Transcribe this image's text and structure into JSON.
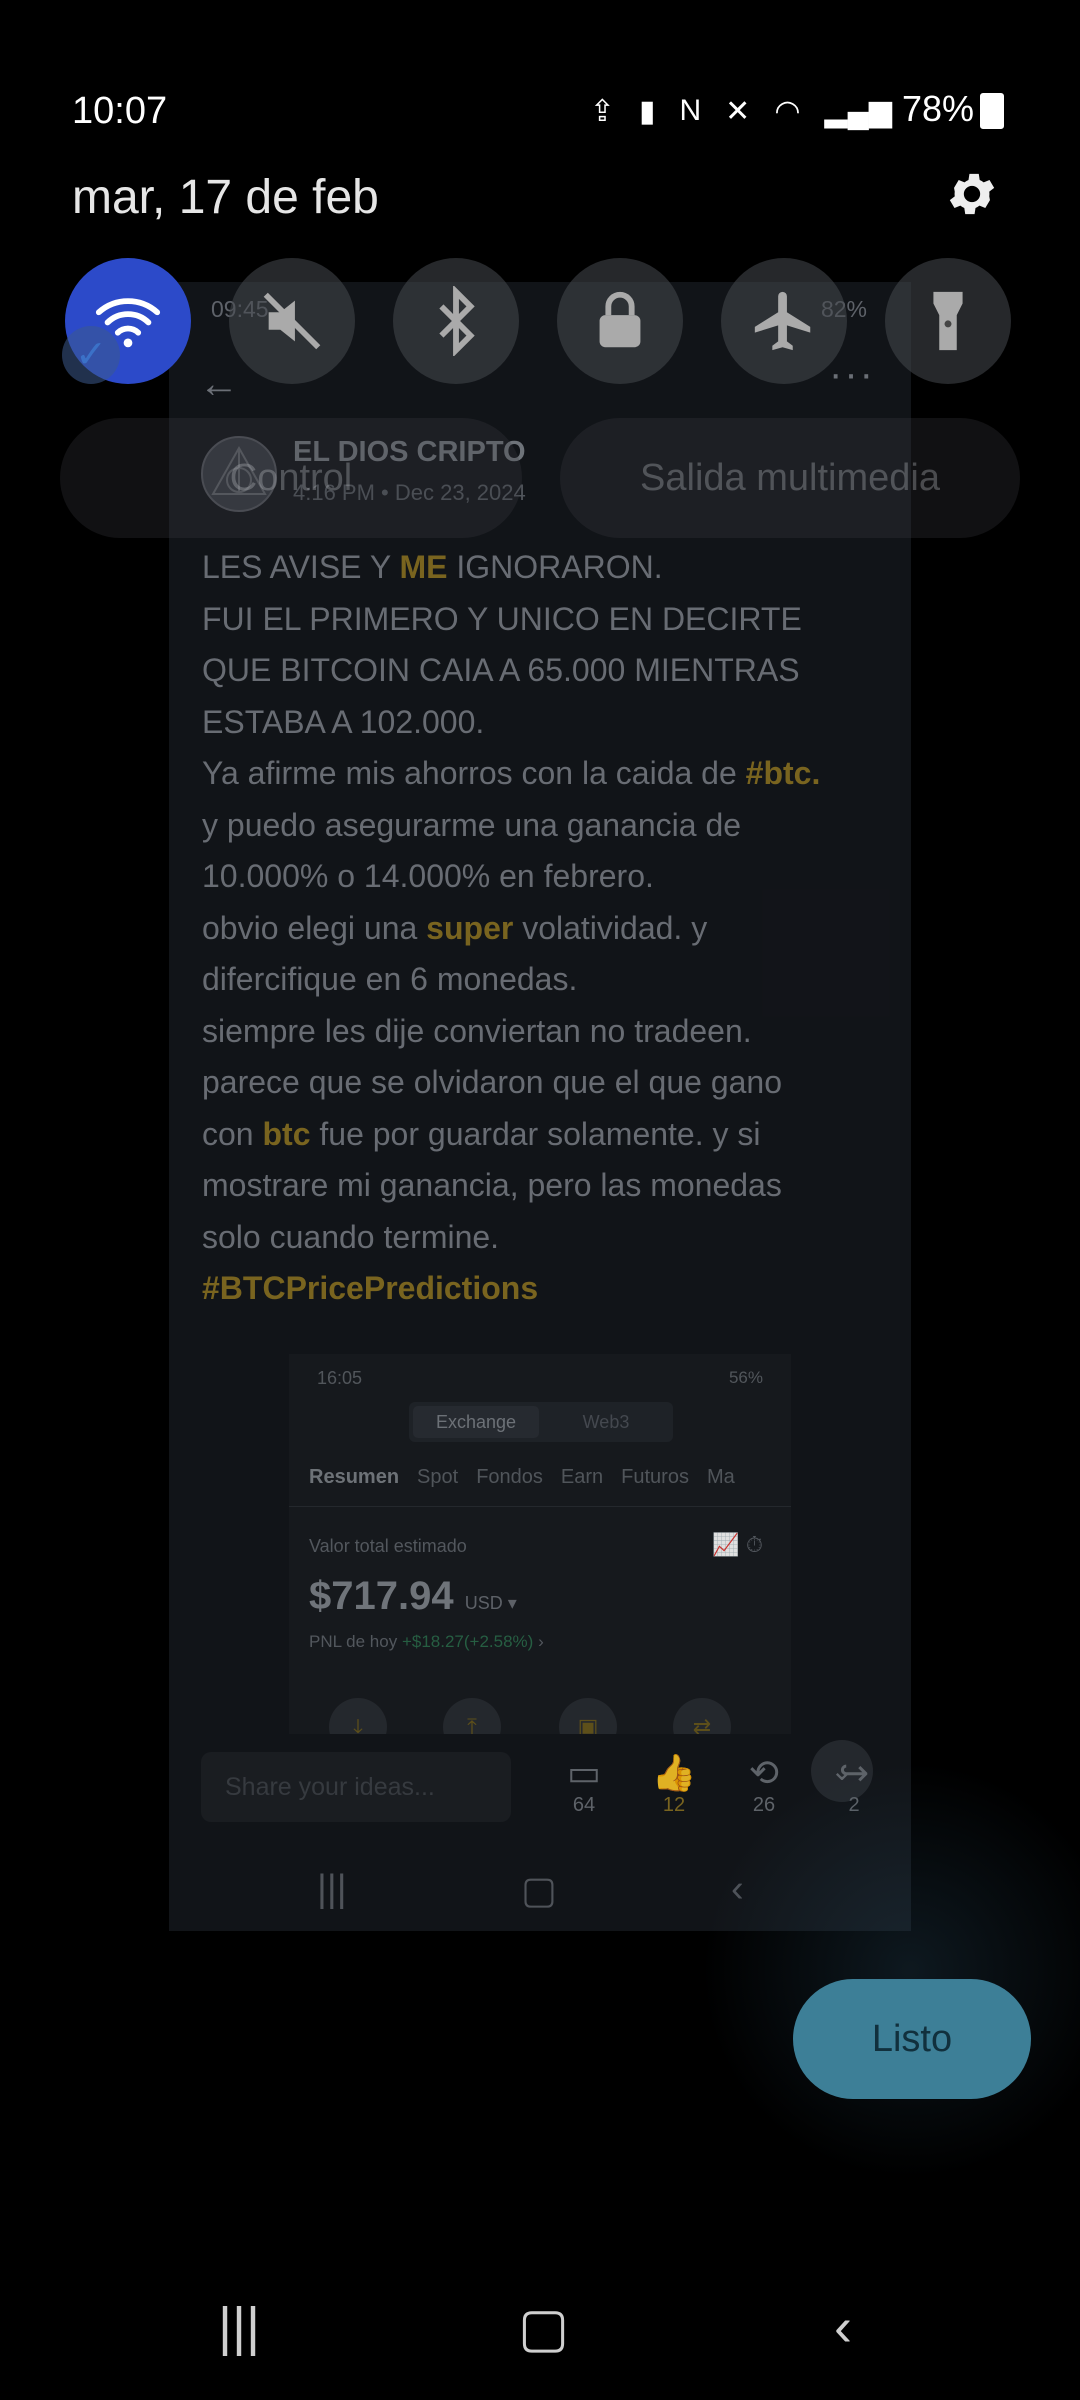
{
  "status_bar": {
    "time": "10:07",
    "battery": "78%"
  },
  "quick_panel": {
    "date": "mar, 17 de feb",
    "tiles": [
      {
        "name": "wifi",
        "active": true
      },
      {
        "name": "mute",
        "active": false
      },
      {
        "name": "bluetooth",
        "active": false
      },
      {
        "name": "rotation-lock",
        "active": false
      },
      {
        "name": "airplane",
        "active": false
      },
      {
        "name": "flashlight",
        "active": false
      }
    ],
    "pills": {
      "control": "Control",
      "media": "Salida multimedia"
    },
    "done_button": "Listo"
  },
  "post": {
    "status_time": "09:45",
    "status_battery": "82%",
    "author": "EL DIOS CRIPTO",
    "date": "4:16 PM • Dec 23, 2024",
    "body": {
      "l1a": "LES AVISE Y ",
      "l1b": "ME",
      "l1c": " IGNORARON.",
      "l2": "FUI EL PRIMERO Y UNICO EN DECIRTE",
      "l3": "QUE BITCOIN CAIA A 65.000 MIENTRAS",
      "l4": "ESTABA A 102.000.",
      "l5a": "Ya afirme mis ahorros con la caida de ",
      "l5b": "#btc.",
      "l6": "y puedo asegurarme una ganancia de",
      "l7": "10.000% o 14.000% en febrero.",
      "l8a": "obvio elegi una ",
      "l8b": "super",
      "l8c": " volatividad. y",
      "l9": "difercifique en 6 monedas.",
      "l10": "siempre les dije conviertan no tradeen.",
      "l11": "parece que se olvidaron que el que gano",
      "l12a": "con ",
      "l12b": "btc",
      "l12c": " fue por guardar solamente. y si",
      "l13": "mostrare mi ganancia, pero las monedas",
      "l14": "solo cuando termine.",
      "l15": "#BTCPricePredictions"
    },
    "embed": {
      "status_time": "16:05",
      "status_battery": "56%",
      "tab_exchange": "Exchange",
      "tab_web3": "Web3",
      "tabs": [
        "Resumen",
        "Spot",
        "Fondos",
        "Earn",
        "Futuros",
        "Ma"
      ],
      "value_label": "Valor total estimado",
      "amount": "$717.94",
      "unit": "USD",
      "pnl_label": "PNL de hoy",
      "pnl_value": "+$18.27(+2.58%)"
    },
    "share_placeholder": "Share your ideas...",
    "actions": {
      "comments": "64",
      "likes": "12",
      "reposts": "26",
      "shares": "2"
    }
  },
  "colors": {
    "accent": "#2c4ac9",
    "done": "#3d7f97",
    "highlight": "#8a7224"
  }
}
